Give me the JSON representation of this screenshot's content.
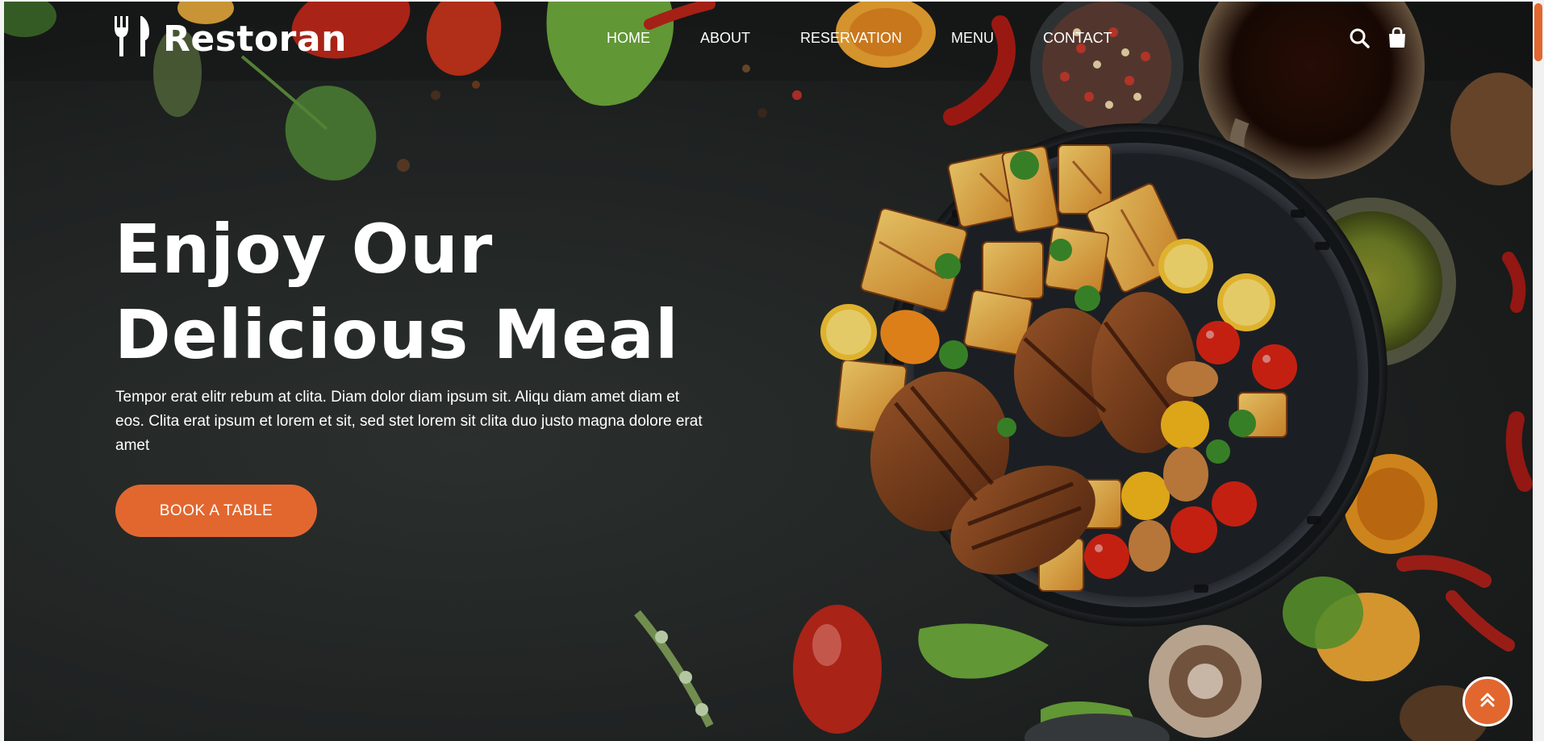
{
  "brand": {
    "name": "Restoran",
    "icon": "fork-knife-icon"
  },
  "nav": {
    "items": [
      "HOME",
      "ABOUT",
      "RESERVATION",
      "MENU",
      "CONTACT"
    ],
    "actions": [
      "search-icon",
      "shopping-bag-icon"
    ]
  },
  "hero": {
    "title_line1": "Enjoy Our",
    "title_line2": "Delicious Meal",
    "description": "Tempor erat elitr rebum at clita. Diam dolor diam ipsum sit. Aliqu diam amet diam et eos. Clita erat ipsum et lorem et sit, sed stet lorem sit clita duo justo magna dolore erat amet",
    "cta_label": "BOOK A TABLE"
  },
  "back_to_top": {
    "icon": "double-chevron-up-icon"
  },
  "colors": {
    "accent": "#e2672f",
    "text": "#ffffff",
    "background": "#23272a"
  }
}
